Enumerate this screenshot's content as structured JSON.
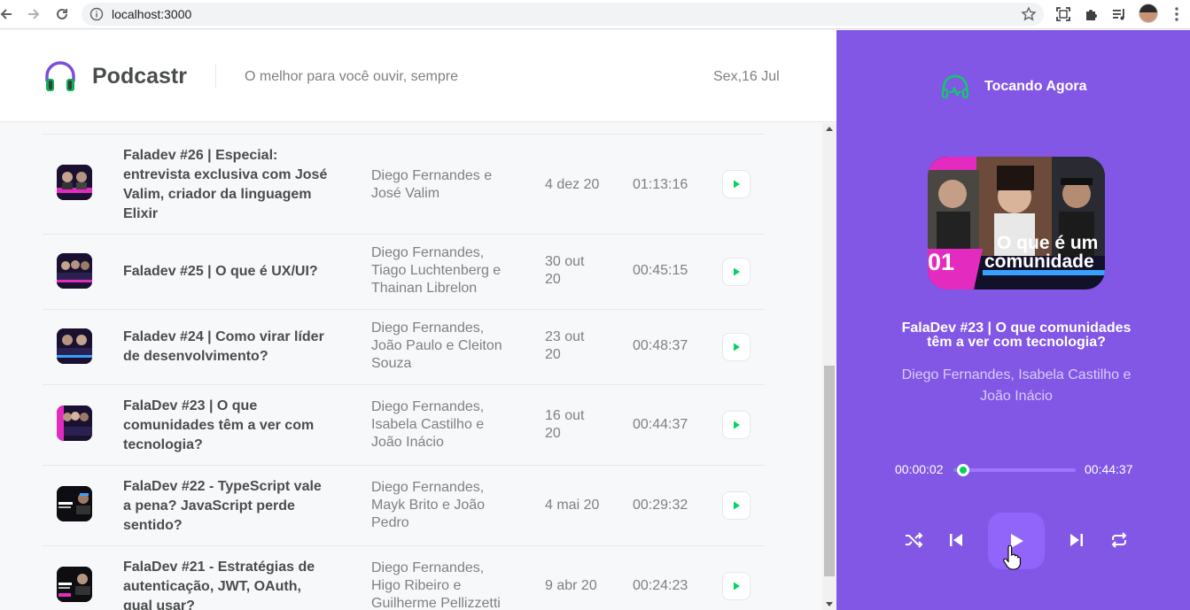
{
  "browser": {
    "url": "localhost:3000"
  },
  "header": {
    "brand": "Podcastr",
    "tagline": "O melhor para você ouvir, sempre",
    "date": "Sex,16 Jul"
  },
  "episodes": [
    {
      "title_lines": [
        "Faladev #26 | Especial:",
        "entrevista exclusiva com José",
        "Valim, criador da linguagem",
        "Elixir"
      ],
      "members_lines": [
        "Diego Fernandes e",
        "José Valim"
      ],
      "date": "4 dez 20",
      "duration": "01:13:16"
    },
    {
      "title_lines": [
        "Faladev #25 | O que é UX/UI?"
      ],
      "members_lines": [
        "Diego Fernandes,",
        "Tiago Luchtenberg e",
        "Thainan Librelon"
      ],
      "date_lines": [
        "30 out",
        "20"
      ],
      "duration": "00:45:15"
    },
    {
      "title_lines": [
        "Faladev #24 | Como virar líder",
        "de desenvolvimento?"
      ],
      "members_lines": [
        "Diego Fernandes,",
        "João Paulo e Cleiton",
        "Souza"
      ],
      "date_lines": [
        "23 out",
        "20"
      ],
      "duration": "00:48:37"
    },
    {
      "title_lines": [
        "FalaDev #23 | O que",
        "comunidades têm a ver com",
        "tecnologia?"
      ],
      "members_lines": [
        "Diego Fernandes,",
        "Isabela Castilho e",
        "João Inácio"
      ],
      "date_lines": [
        "16 out",
        "20"
      ],
      "duration": "00:44:37"
    },
    {
      "title_lines": [
        "FalaDev #22 - TypeScript vale",
        "a pena? JavaScript perde",
        "sentido?"
      ],
      "members_lines": [
        "Diego Fernandes,",
        "Mayk Brito e João",
        "Pedro"
      ],
      "date": "4 mai 20",
      "duration": "00:29:32"
    },
    {
      "title_lines": [
        "FalaDev #21 - Estratégias de",
        "autenticação, JWT, OAuth,",
        "qual usar?"
      ],
      "members_lines": [
        "Diego Fernandes,",
        "Higo Ribeiro e",
        "Guilherme Pellizzetti"
      ],
      "date": "9 abr 20",
      "duration": "00:24:23"
    }
  ],
  "player": {
    "heading": "Tocando Agora",
    "cover_text_line1": "O que é um",
    "cover_text_line2": "comunidade",
    "cover_number": "01",
    "title_lines": [
      "FalaDev #23 | O que comunidades",
      "têm a ver com tecnologia?"
    ],
    "members_lines": [
      "Diego Fernandes, Isabela Castilho e",
      "João Inácio"
    ],
    "current_time": "00:00:02",
    "total_time": "00:44:37",
    "progress": 0.001
  },
  "colors": {
    "brand_purple": "#8257e5",
    "accent_green": "#04d361",
    "text_dark": "#494d4b",
    "text_gray": "#808080"
  },
  "icons": {
    "logo": "headphones-icon",
    "player_head": "headphones-pulse-icon",
    "shuffle": "shuffle-icon",
    "previous": "skip-previous-icon",
    "play": "play-icon",
    "next": "skip-next-icon",
    "repeat": "repeat-icon"
  }
}
